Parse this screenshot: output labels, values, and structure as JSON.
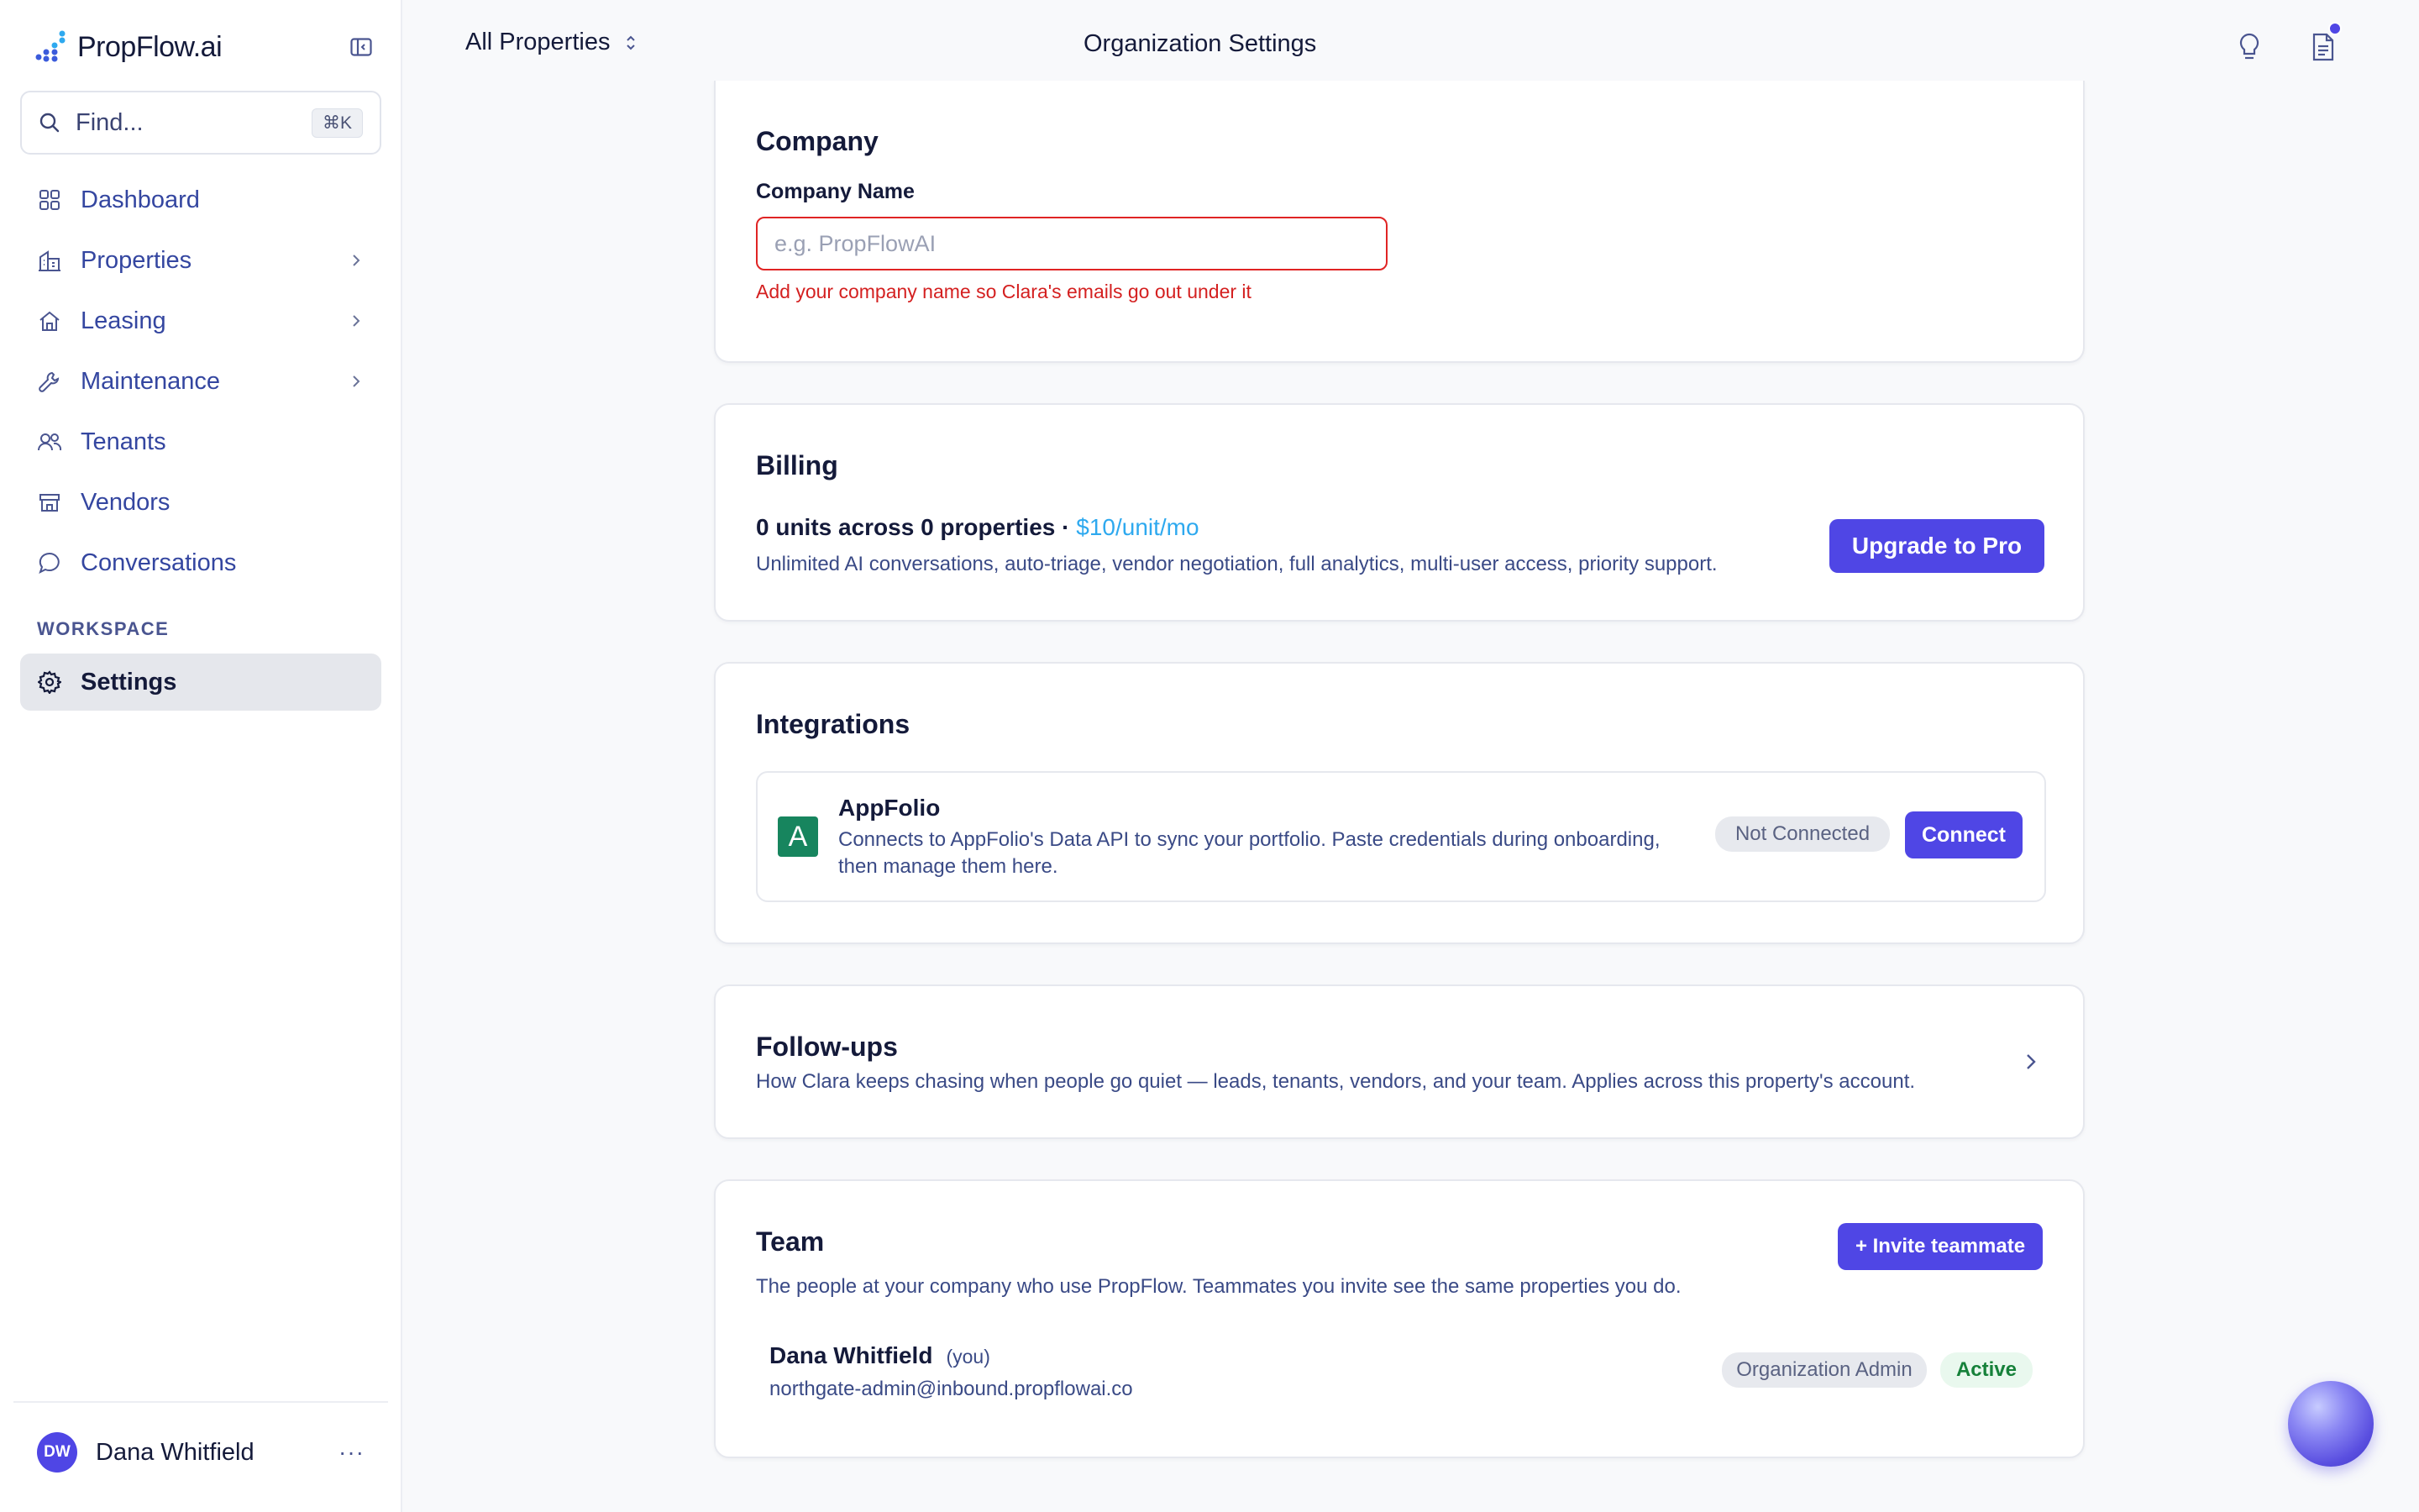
{
  "brand": {
    "name": "PropFlow.ai"
  },
  "sidebar": {
    "search": {
      "placeholder": "Find...",
      "shortcut": "⌘K"
    },
    "items": [
      {
        "label": "Dashboard",
        "icon": "grid-icon"
      },
      {
        "label": "Properties",
        "icon": "building-icon",
        "has_children": true
      },
      {
        "label": "Leasing",
        "icon": "home-icon",
        "has_children": true
      },
      {
        "label": "Maintenance",
        "icon": "wrench-icon",
        "has_children": true
      },
      {
        "label": "Tenants",
        "icon": "users-icon"
      },
      {
        "label": "Vendors",
        "icon": "store-icon"
      },
      {
        "label": "Conversations",
        "icon": "chat-bubble-icon"
      }
    ],
    "workspace_label": "WORKSPACE",
    "workspace_items": [
      {
        "label": "Settings",
        "icon": "gear-icon",
        "active": true
      }
    ],
    "user": {
      "initials": "DW",
      "name": "Dana Whitfield",
      "more": "···"
    }
  },
  "topbar": {
    "property_selector": "All Properties",
    "title": "Organization Settings"
  },
  "company": {
    "title": "Company",
    "field_label": "Company Name",
    "placeholder": "e.g. PropFlowAI",
    "value": "",
    "error": "Add your company name so Clara's emails go out under it"
  },
  "billing": {
    "title": "Billing",
    "summary": "0 units across 0 properties",
    "separator": " · ",
    "price": "$10/unit/mo",
    "description": "Unlimited AI conversations, auto-triage, vendor negotiation, full analytics, multi-user access, priority support.",
    "upgrade_label": "Upgrade to Pro"
  },
  "integrations": {
    "title": "Integrations",
    "items": [
      {
        "name": "AppFolio",
        "logo_letter": "A",
        "description": "Connects to AppFolio's Data API to sync your portfolio. Paste credentials during onboarding, then manage them here.",
        "status": "Not Connected",
        "action": "Connect"
      }
    ]
  },
  "followups": {
    "title": "Follow-ups",
    "description": "How Clara keeps chasing when people go quiet — leads, tenants, vendors, and your team. Applies across this property's account."
  },
  "team": {
    "title": "Team",
    "invite_label": "+ Invite teammate",
    "description": "The people at your company who use PropFlow. Teammates you invite see the same properties you do.",
    "members": [
      {
        "name": "Dana Whitfield",
        "you_label": "(you)",
        "email": "northgate-admin@inbound.propflowai.co",
        "role": "Organization Admin",
        "status": "Active"
      }
    ]
  },
  "colors": {
    "accent": "#4f46e5",
    "price": "#2ea9ef",
    "error": "#e02424",
    "active_status": "#16813a"
  }
}
